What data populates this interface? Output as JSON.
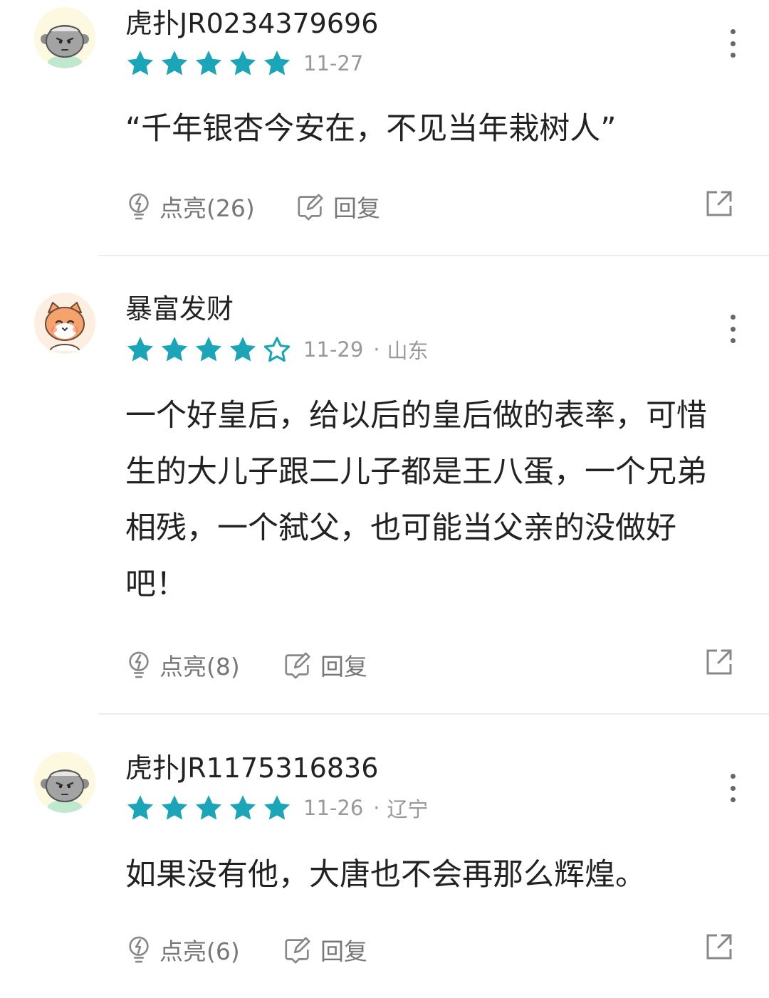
{
  "colors": {
    "star_fill": "#1ba5b8",
    "meta_text": "#999999",
    "action_text": "#777777"
  },
  "comments": [
    {
      "username": "虎扑JR0234379696",
      "avatar": "gray-mascot-avatar",
      "stars": 5,
      "date": "11-27",
      "location": "",
      "content": "“千年银杏今安在，不见当年栽树人”",
      "like_label": "点亮(26)",
      "reply_label": "回复"
    },
    {
      "username": "暴富发财",
      "avatar": "orange-cat-avatar",
      "stars": 4,
      "date": "11-29",
      "separator": "·",
      "location": "山东",
      "content": "一个好皇后，给以后的皇后做的表率，可惜生的大儿子跟二儿子都是王八蛋，一个兄弟相残，一个弑父，也可能当父亲的没做好吧！",
      "like_label": "点亮(8)",
      "reply_label": "回复"
    },
    {
      "username": "虎扑JR1175316836",
      "avatar": "gray-mascot-avatar",
      "stars": 5,
      "date": "11-26",
      "separator": "·",
      "location": "辽宁",
      "content": "如果没有他，大唐也不会再那么辉煌。",
      "like_label": "点亮(6)",
      "reply_label": "回复"
    }
  ]
}
